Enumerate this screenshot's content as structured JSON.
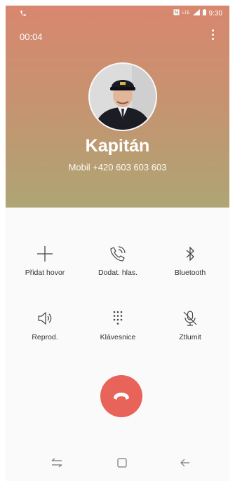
{
  "status_bar": {
    "left_icon": "phone-icon",
    "right_icons": [
      "nfc-icon",
      "lte-icon",
      "signal-icon",
      "battery-icon"
    ],
    "lte_text": "LTE",
    "time": "9:30"
  },
  "call": {
    "timer": "00:04",
    "contact_name": "Kapitán",
    "number_line": "Mobil +420 603 603 603"
  },
  "controls": [
    {
      "label": "Přidat hovor",
      "icon": "plus-icon"
    },
    {
      "label": "Dodat. hlas.",
      "icon": "phone-volume-icon"
    },
    {
      "label": "Bluetooth",
      "icon": "bluetooth-icon"
    },
    {
      "label": "Reprod.",
      "icon": "speaker-icon"
    },
    {
      "label": "Klávesnice",
      "icon": "keypad-icon"
    },
    {
      "label": "Ztlumit",
      "icon": "mic-mute-icon"
    }
  ],
  "end_call": {
    "icon": "end-call-icon",
    "color": "#e8635a"
  },
  "navbar": [
    "recent-apps-icon",
    "home-icon",
    "back-icon"
  ],
  "colors": {
    "gradient_top": "#d8876f",
    "gradient_bottom": "#aea574",
    "end_call": "#e8635a"
  }
}
